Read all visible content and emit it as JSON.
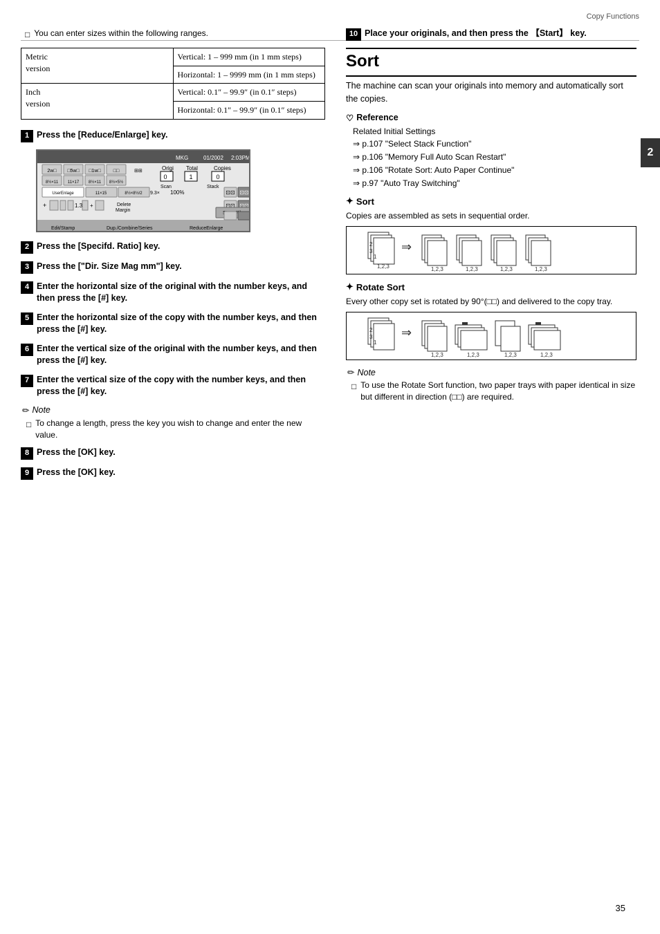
{
  "header": {
    "title": "Copy Functions"
  },
  "page_number": "35",
  "chapter_tab": "2",
  "left_col": {
    "intro_checkbox": "You can enter sizes within the following ranges.",
    "table": {
      "rows": [
        {
          "label": "Metric version",
          "cells": [
            "Vertical: 1 – 999 mm (in 1 mm steps)",
            "Horizontal: 1 – 9999 mm (in 1 mm steps)"
          ]
        },
        {
          "label": "Inch version",
          "cells": [
            "Vertical: 0.1\" – 99.9\" (in 0.1\" steps)",
            "Horizontal: 0.1\" – 99.9\" (in 0.1\" steps)"
          ]
        }
      ]
    },
    "steps": [
      {
        "num": "1",
        "text": "Press the [Reduce/Enlarge] key."
      },
      {
        "num": "2",
        "text": "Press the [Specifd. Ratio] key."
      },
      {
        "num": "3",
        "text": "Press the [\"Dir. Size Mag mm\"] key."
      },
      {
        "num": "4",
        "text": "Enter the horizontal size of the original with the number keys, and then press the [#] key."
      },
      {
        "num": "5",
        "text": "Enter the horizontal size of the copy with the number keys, and then press the [#] key."
      },
      {
        "num": "6",
        "text": "Enter the vertical size of the original with the number keys, and then press the [#] key."
      },
      {
        "num": "7",
        "text": "Enter the vertical size of the copy with the number keys, and then press the [#] key."
      }
    ],
    "note": {
      "title": "Note",
      "items": [
        "To change a length, press the key you wish to change and enter the new value."
      ]
    },
    "steps_after_note": [
      {
        "num": "8",
        "text": "Press the [OK] key."
      },
      {
        "num": "9",
        "text": "Press the [OK] key."
      }
    ]
  },
  "right_col": {
    "step_10": {
      "num": "10",
      "text": "Place your originals, and then press the 『Start』 key."
    },
    "sort_section": {
      "title": "Sort",
      "intro": "The machine can scan your originals into memory and automatically sort the copies.",
      "reference": {
        "title": "Reference",
        "items": [
          "Related Initial Settings",
          "⇒ p.107 “Select Stack Function”",
          "⇒ p.106 “Memory Full Auto Scan Restart”",
          "⇒ p.106 “Rotate Sort: Auto Paper Continue”",
          "⇒ p.97 “Auto Tray Switching”"
        ]
      },
      "sort_sub": {
        "title": "Sort",
        "text": "Copies are assembled as sets in sequential order."
      },
      "rotate_sort_sub": {
        "title": "Rotate Sort",
        "text": "Every other copy set is rotated by 90°(□□) and delivered to the copy tray."
      },
      "note": {
        "title": "Note",
        "items": [
          "To use the Rotate Sort function, two paper trays with paper identical in size but different in direction (□□) are required."
        ]
      }
    }
  }
}
